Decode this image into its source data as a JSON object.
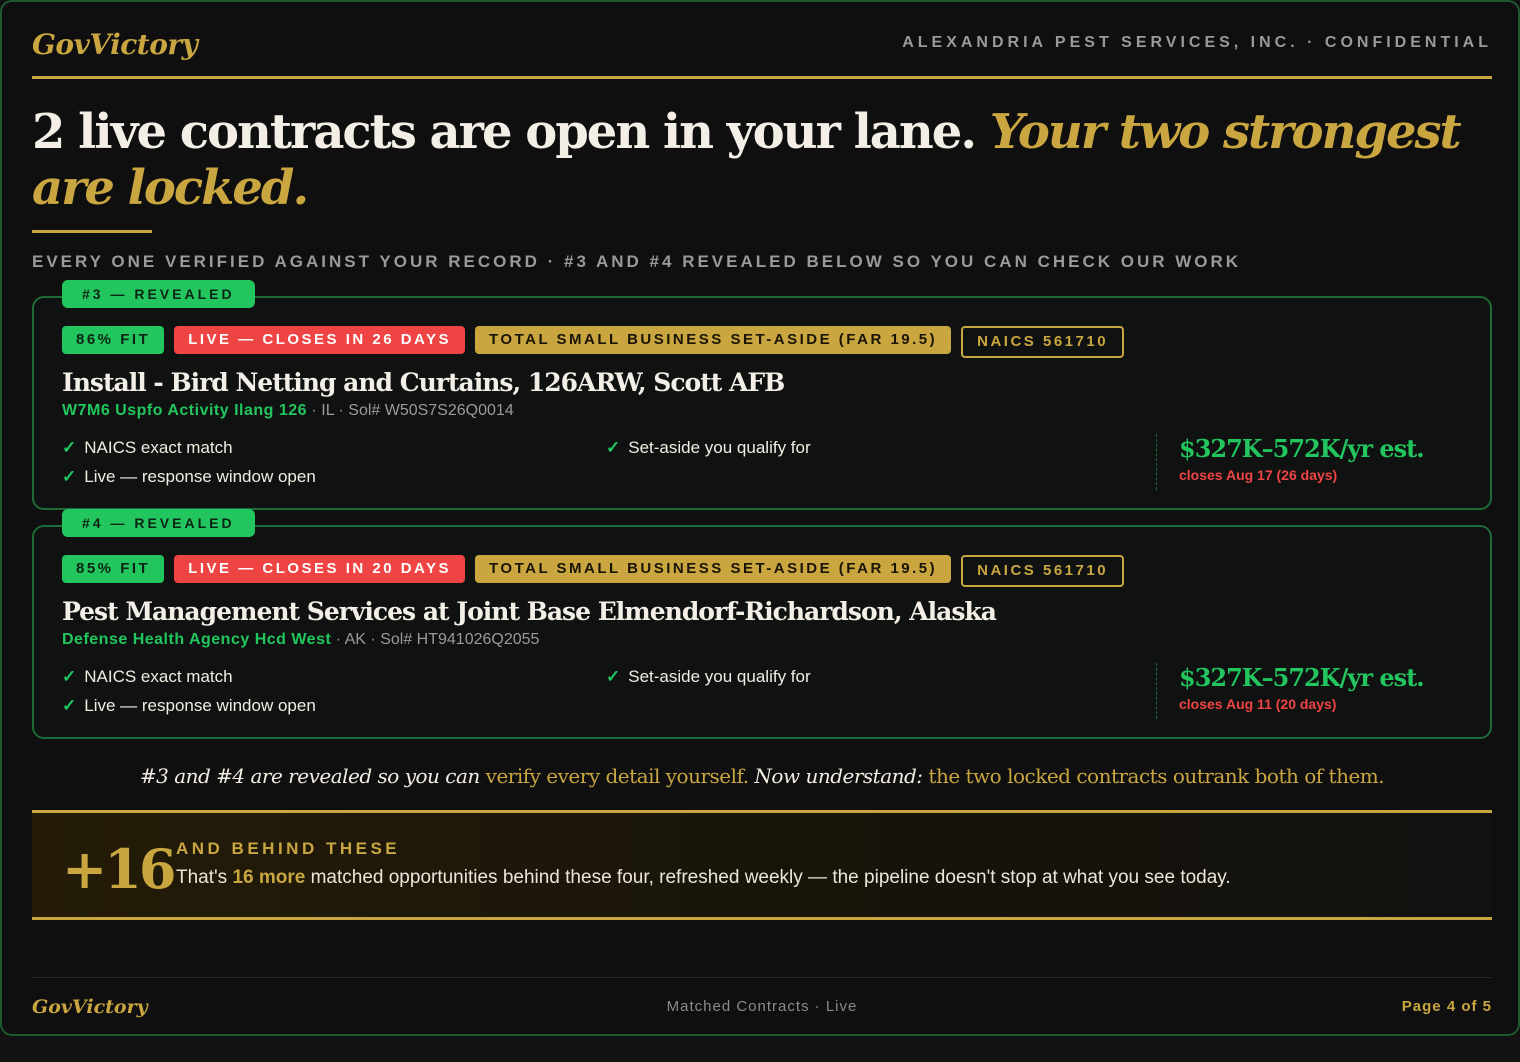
{
  "header": {
    "brand": "GovVictory",
    "confidential": "ALEXANDRIA PEST SERVICES, INC. · CONFIDENTIAL"
  },
  "headline": {
    "main": "2 live contracts are open in your lane. ",
    "accent": "Your two strongest are locked."
  },
  "subline": "EVERY ONE VERIFIED AGAINST YOUR RECORD · #3 AND #4 REVEALED BELOW SO YOU CAN CHECK OUR WORK",
  "contracts": [
    {
      "ribbon": "#3 — REVEALED",
      "fit": "86% FIT",
      "live": "LIVE — CLOSES IN 26 DAYS",
      "setaside": "TOTAL SMALL BUSINESS SET-ASIDE (FAR 19.5)",
      "naics": "NAICS 561710",
      "title": "Install - Bird Netting and Curtains, 126ARW, Scott AFB",
      "agency": "W7M6 Uspfo Activity Ilang 126",
      "location": " · IL · Sol# W50S7S26Q0014",
      "check1": "NAICS exact match",
      "check2": "Live — response window open",
      "check3": "Set-aside you qualify for",
      "value": "$327K–572K/yr est.",
      "closes": "closes Aug 17 (26 days)"
    },
    {
      "ribbon": "#4 — REVEALED",
      "fit": "85% FIT",
      "live": "LIVE — CLOSES IN 20 DAYS",
      "setaside": "TOTAL SMALL BUSINESS SET-ASIDE (FAR 19.5)",
      "naics": "NAICS 561710",
      "title": "Pest Management Services at Joint Base Elmendorf-Richardson, Alaska",
      "agency": "Defense Health Agency Hcd West",
      "location": " · AK · Sol# HT941026Q2055",
      "check1": "NAICS exact match",
      "check2": "Live — response window open",
      "check3": "Set-aside you qualify for",
      "value": "$327K–572K/yr est.",
      "closes": "closes Aug 11 (20 days)"
    }
  ],
  "verify": {
    "p1": "#3 and #4 are revealed so you can ",
    "p2": "verify every detail yourself.",
    "p3": " Now understand: ",
    "p4": "the two locked contracts outrank both of them."
  },
  "behind": {
    "count": "+16",
    "heading": "AND BEHIND THESE",
    "t1": "That's ",
    "t2": "16 more",
    "t3": " matched opportunities behind these four, refreshed weekly — the pipeline doesn't stop at what you see today."
  },
  "footer": {
    "brand": "GovVictory",
    "center": "Matched Contracts · Live",
    "page": "Page 4 of 5"
  },
  "colors": {
    "gold": "#c9a640",
    "green": "#22c55e",
    "red": "#ef4444",
    "background": "#0f0f10"
  }
}
